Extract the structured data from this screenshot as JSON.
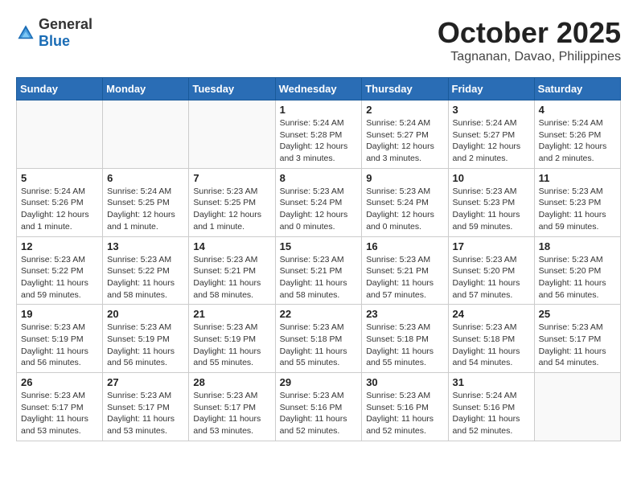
{
  "logo": {
    "general": "General",
    "blue": "Blue"
  },
  "header": {
    "month": "October 2025",
    "location": "Tagnanan, Davao, Philippines"
  },
  "weekdays": [
    "Sunday",
    "Monday",
    "Tuesday",
    "Wednesday",
    "Thursday",
    "Friday",
    "Saturday"
  ],
  "weeks": [
    [
      {
        "day": "",
        "sunrise": "",
        "sunset": "",
        "daylight": "",
        "empty": true
      },
      {
        "day": "",
        "sunrise": "",
        "sunset": "",
        "daylight": "",
        "empty": true
      },
      {
        "day": "",
        "sunrise": "",
        "sunset": "",
        "daylight": "",
        "empty": true
      },
      {
        "day": "1",
        "sunrise": "Sunrise: 5:24 AM",
        "sunset": "Sunset: 5:28 PM",
        "daylight": "Daylight: 12 hours and 3 minutes."
      },
      {
        "day": "2",
        "sunrise": "Sunrise: 5:24 AM",
        "sunset": "Sunset: 5:27 PM",
        "daylight": "Daylight: 12 hours and 3 minutes."
      },
      {
        "day": "3",
        "sunrise": "Sunrise: 5:24 AM",
        "sunset": "Sunset: 5:27 PM",
        "daylight": "Daylight: 12 hours and 2 minutes."
      },
      {
        "day": "4",
        "sunrise": "Sunrise: 5:24 AM",
        "sunset": "Sunset: 5:26 PM",
        "daylight": "Daylight: 12 hours and 2 minutes."
      }
    ],
    [
      {
        "day": "5",
        "sunrise": "Sunrise: 5:24 AM",
        "sunset": "Sunset: 5:26 PM",
        "daylight": "Daylight: 12 hours and 1 minute."
      },
      {
        "day": "6",
        "sunrise": "Sunrise: 5:24 AM",
        "sunset": "Sunset: 5:25 PM",
        "daylight": "Daylight: 12 hours and 1 minute."
      },
      {
        "day": "7",
        "sunrise": "Sunrise: 5:23 AM",
        "sunset": "Sunset: 5:25 PM",
        "daylight": "Daylight: 12 hours and 1 minute."
      },
      {
        "day": "8",
        "sunrise": "Sunrise: 5:23 AM",
        "sunset": "Sunset: 5:24 PM",
        "daylight": "Daylight: 12 hours and 0 minutes."
      },
      {
        "day": "9",
        "sunrise": "Sunrise: 5:23 AM",
        "sunset": "Sunset: 5:24 PM",
        "daylight": "Daylight: 12 hours and 0 minutes."
      },
      {
        "day": "10",
        "sunrise": "Sunrise: 5:23 AM",
        "sunset": "Sunset: 5:23 PM",
        "daylight": "Daylight: 11 hours and 59 minutes."
      },
      {
        "day": "11",
        "sunrise": "Sunrise: 5:23 AM",
        "sunset": "Sunset: 5:23 PM",
        "daylight": "Daylight: 11 hours and 59 minutes."
      }
    ],
    [
      {
        "day": "12",
        "sunrise": "Sunrise: 5:23 AM",
        "sunset": "Sunset: 5:22 PM",
        "daylight": "Daylight: 11 hours and 59 minutes."
      },
      {
        "day": "13",
        "sunrise": "Sunrise: 5:23 AM",
        "sunset": "Sunset: 5:22 PM",
        "daylight": "Daylight: 11 hours and 58 minutes."
      },
      {
        "day": "14",
        "sunrise": "Sunrise: 5:23 AM",
        "sunset": "Sunset: 5:21 PM",
        "daylight": "Daylight: 11 hours and 58 minutes."
      },
      {
        "day": "15",
        "sunrise": "Sunrise: 5:23 AM",
        "sunset": "Sunset: 5:21 PM",
        "daylight": "Daylight: 11 hours and 58 minutes."
      },
      {
        "day": "16",
        "sunrise": "Sunrise: 5:23 AM",
        "sunset": "Sunset: 5:21 PM",
        "daylight": "Daylight: 11 hours and 57 minutes."
      },
      {
        "day": "17",
        "sunrise": "Sunrise: 5:23 AM",
        "sunset": "Sunset: 5:20 PM",
        "daylight": "Daylight: 11 hours and 57 minutes."
      },
      {
        "day": "18",
        "sunrise": "Sunrise: 5:23 AM",
        "sunset": "Sunset: 5:20 PM",
        "daylight": "Daylight: 11 hours and 56 minutes."
      }
    ],
    [
      {
        "day": "19",
        "sunrise": "Sunrise: 5:23 AM",
        "sunset": "Sunset: 5:19 PM",
        "daylight": "Daylight: 11 hours and 56 minutes."
      },
      {
        "day": "20",
        "sunrise": "Sunrise: 5:23 AM",
        "sunset": "Sunset: 5:19 PM",
        "daylight": "Daylight: 11 hours and 56 minutes."
      },
      {
        "day": "21",
        "sunrise": "Sunrise: 5:23 AM",
        "sunset": "Sunset: 5:19 PM",
        "daylight": "Daylight: 11 hours and 55 minutes."
      },
      {
        "day": "22",
        "sunrise": "Sunrise: 5:23 AM",
        "sunset": "Sunset: 5:18 PM",
        "daylight": "Daylight: 11 hours and 55 minutes."
      },
      {
        "day": "23",
        "sunrise": "Sunrise: 5:23 AM",
        "sunset": "Sunset: 5:18 PM",
        "daylight": "Daylight: 11 hours and 55 minutes."
      },
      {
        "day": "24",
        "sunrise": "Sunrise: 5:23 AM",
        "sunset": "Sunset: 5:18 PM",
        "daylight": "Daylight: 11 hours and 54 minutes."
      },
      {
        "day": "25",
        "sunrise": "Sunrise: 5:23 AM",
        "sunset": "Sunset: 5:17 PM",
        "daylight": "Daylight: 11 hours and 54 minutes."
      }
    ],
    [
      {
        "day": "26",
        "sunrise": "Sunrise: 5:23 AM",
        "sunset": "Sunset: 5:17 PM",
        "daylight": "Daylight: 11 hours and 53 minutes."
      },
      {
        "day": "27",
        "sunrise": "Sunrise: 5:23 AM",
        "sunset": "Sunset: 5:17 PM",
        "daylight": "Daylight: 11 hours and 53 minutes."
      },
      {
        "day": "28",
        "sunrise": "Sunrise: 5:23 AM",
        "sunset": "Sunset: 5:17 PM",
        "daylight": "Daylight: 11 hours and 53 minutes."
      },
      {
        "day": "29",
        "sunrise": "Sunrise: 5:23 AM",
        "sunset": "Sunset: 5:16 PM",
        "daylight": "Daylight: 11 hours and 52 minutes."
      },
      {
        "day": "30",
        "sunrise": "Sunrise: 5:23 AM",
        "sunset": "Sunset: 5:16 PM",
        "daylight": "Daylight: 11 hours and 52 minutes."
      },
      {
        "day": "31",
        "sunrise": "Sunrise: 5:24 AM",
        "sunset": "Sunset: 5:16 PM",
        "daylight": "Daylight: 11 hours and 52 minutes."
      },
      {
        "day": "",
        "sunrise": "",
        "sunset": "",
        "daylight": "",
        "empty": true
      }
    ]
  ]
}
